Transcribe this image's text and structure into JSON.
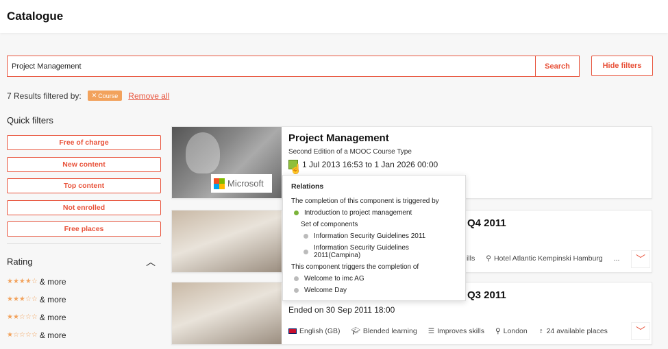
{
  "header": {
    "title": "Catalogue"
  },
  "search": {
    "value": "Project Management",
    "button": "Search"
  },
  "hide_filters": "Hide filters",
  "results": {
    "text": "7 Results filtered by:",
    "chip": "Course",
    "remove_all": "Remove all"
  },
  "quick_filters": {
    "title": "Quick filters",
    "items": [
      "Free of charge",
      "New content",
      "Top content",
      "Not enrolled",
      "Free places"
    ]
  },
  "rating": {
    "title": "Rating",
    "rows": [
      {
        "stars": "★★★★☆",
        "label": "& more"
      },
      {
        "stars": "★★★☆☆",
        "label": "& more"
      },
      {
        "stars": "★★☆☆☆",
        "label": "& more"
      },
      {
        "stars": "★☆☆☆☆",
        "label": "& more"
      }
    ]
  },
  "cards": [
    {
      "title": "Project Management",
      "subtitle": "Second Edition of a MOOC Course Type",
      "date": "1 Jul 2013 16:53 to 1 Jan 2026 00:00",
      "logo_text": "Microsoft"
    },
    {
      "title_suffix": "Q4 2011",
      "meta": [
        "ills",
        "Hotel Atlantic Kempinski Hamburg",
        "..."
      ]
    },
    {
      "title_suffix": "Q3 2011",
      "date": "Ended on 30 Sep 2011 18:00",
      "meta": [
        "English (GB)",
        "Blended learning",
        "Improves skills",
        "London",
        "24 available places"
      ]
    }
  ],
  "popup": {
    "title": "Relations",
    "triggered_by": "The completion of this component is triggered by",
    "intro": "Introduction to project management",
    "set": "Set of components",
    "set_items": [
      "Information Security Guidelines 2011",
      "Information Security Guidelines 2011(Campina)"
    ],
    "triggers": "This component triggers the completion of",
    "trigger_items": [
      "Welcome to imc AG",
      "Welcome Day"
    ]
  },
  "colors": {
    "accent": "#e8523a",
    "chip": "#f2a25c",
    "green": "#7bb33a"
  }
}
